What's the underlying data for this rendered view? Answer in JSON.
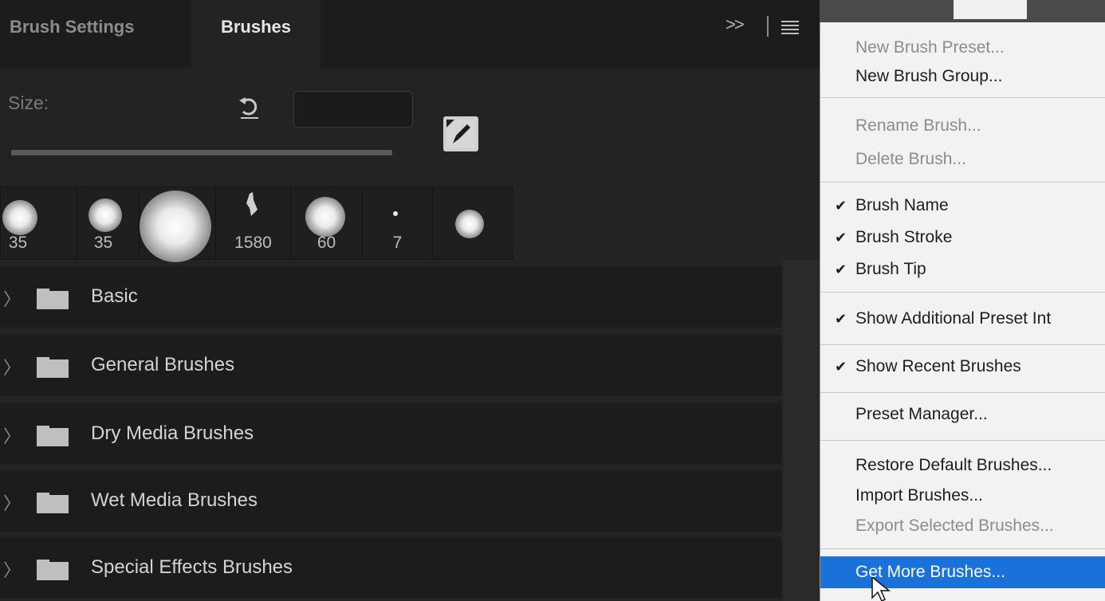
{
  "tabs": {
    "brush_settings": "Brush Settings",
    "brushes": "Brushes"
  },
  "size": {
    "label": "Size:",
    "value": ""
  },
  "recent_brushes": [
    {
      "size": "35"
    },
    {
      "size": "35"
    },
    {
      "size": ""
    },
    {
      "size": "1580"
    },
    {
      "size": "60"
    },
    {
      "size": "7"
    },
    {
      "size": ""
    }
  ],
  "groups": [
    {
      "name": "Basic"
    },
    {
      "name": "General Brushes"
    },
    {
      "name": "Dry Media Brushes"
    },
    {
      "name": "Wet Media Brushes"
    },
    {
      "name": "Special Effects Brushes"
    }
  ],
  "menu": {
    "new_brush_preset": "New Brush Preset...",
    "new_brush_group": "New Brush Group...",
    "rename_brush": "Rename Brush...",
    "delete_brush": "Delete Brush...",
    "brush_name": "Brush Name",
    "brush_stroke": "Brush Stroke",
    "brush_tip": "Brush Tip",
    "show_additional_preset_info": "Show Additional Preset Int",
    "show_recent_brushes": "Show Recent Brushes",
    "preset_manager": "Preset Manager...",
    "restore_default_brushes": "Restore Default Brushes...",
    "import_brushes": "Import Brushes...",
    "export_selected_brushes": "Export Selected Brushes...",
    "get_more_brushes": "Get More Brushes...",
    "check_glyph": "✔"
  },
  "colors": {
    "panel": "#232323",
    "menu": "#f2f2f2",
    "highlight": "#1a72d9"
  }
}
